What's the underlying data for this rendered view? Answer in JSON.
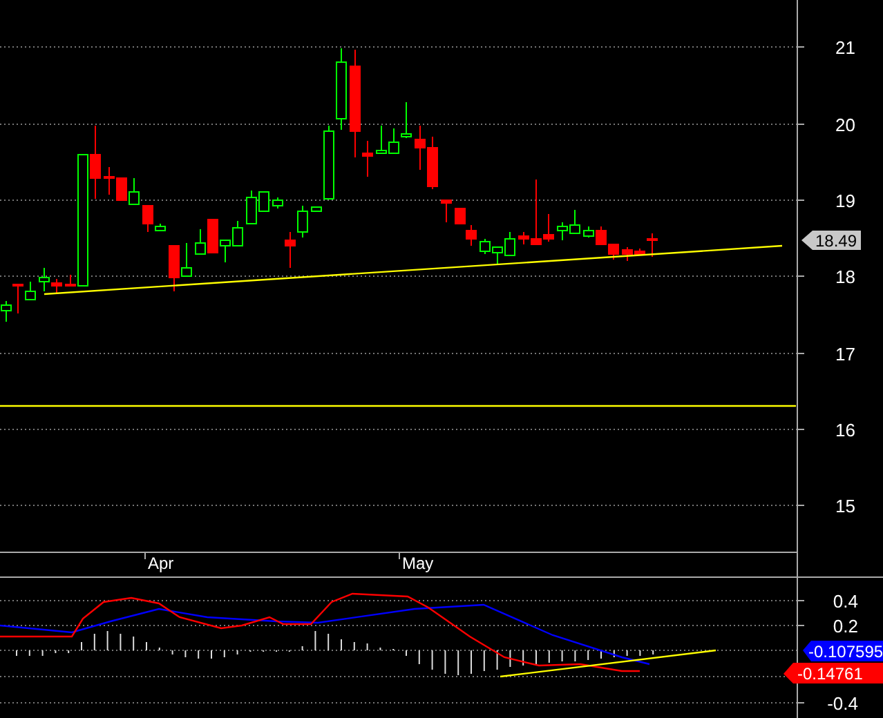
{
  "price_panel": {
    "y_axis_labels": [
      "21",
      "20",
      "19",
      "18",
      "17",
      "16",
      "15"
    ],
    "last_price": "18.49"
  },
  "date_axis": {
    "labels": [
      "Apr",
      "May"
    ]
  },
  "macd_panel": {
    "y_axis_labels": [
      "0.4",
      "0.2",
      "-0.4"
    ],
    "macd_value": "-0.107595",
    "signal_value": "-0.14761"
  }
}
